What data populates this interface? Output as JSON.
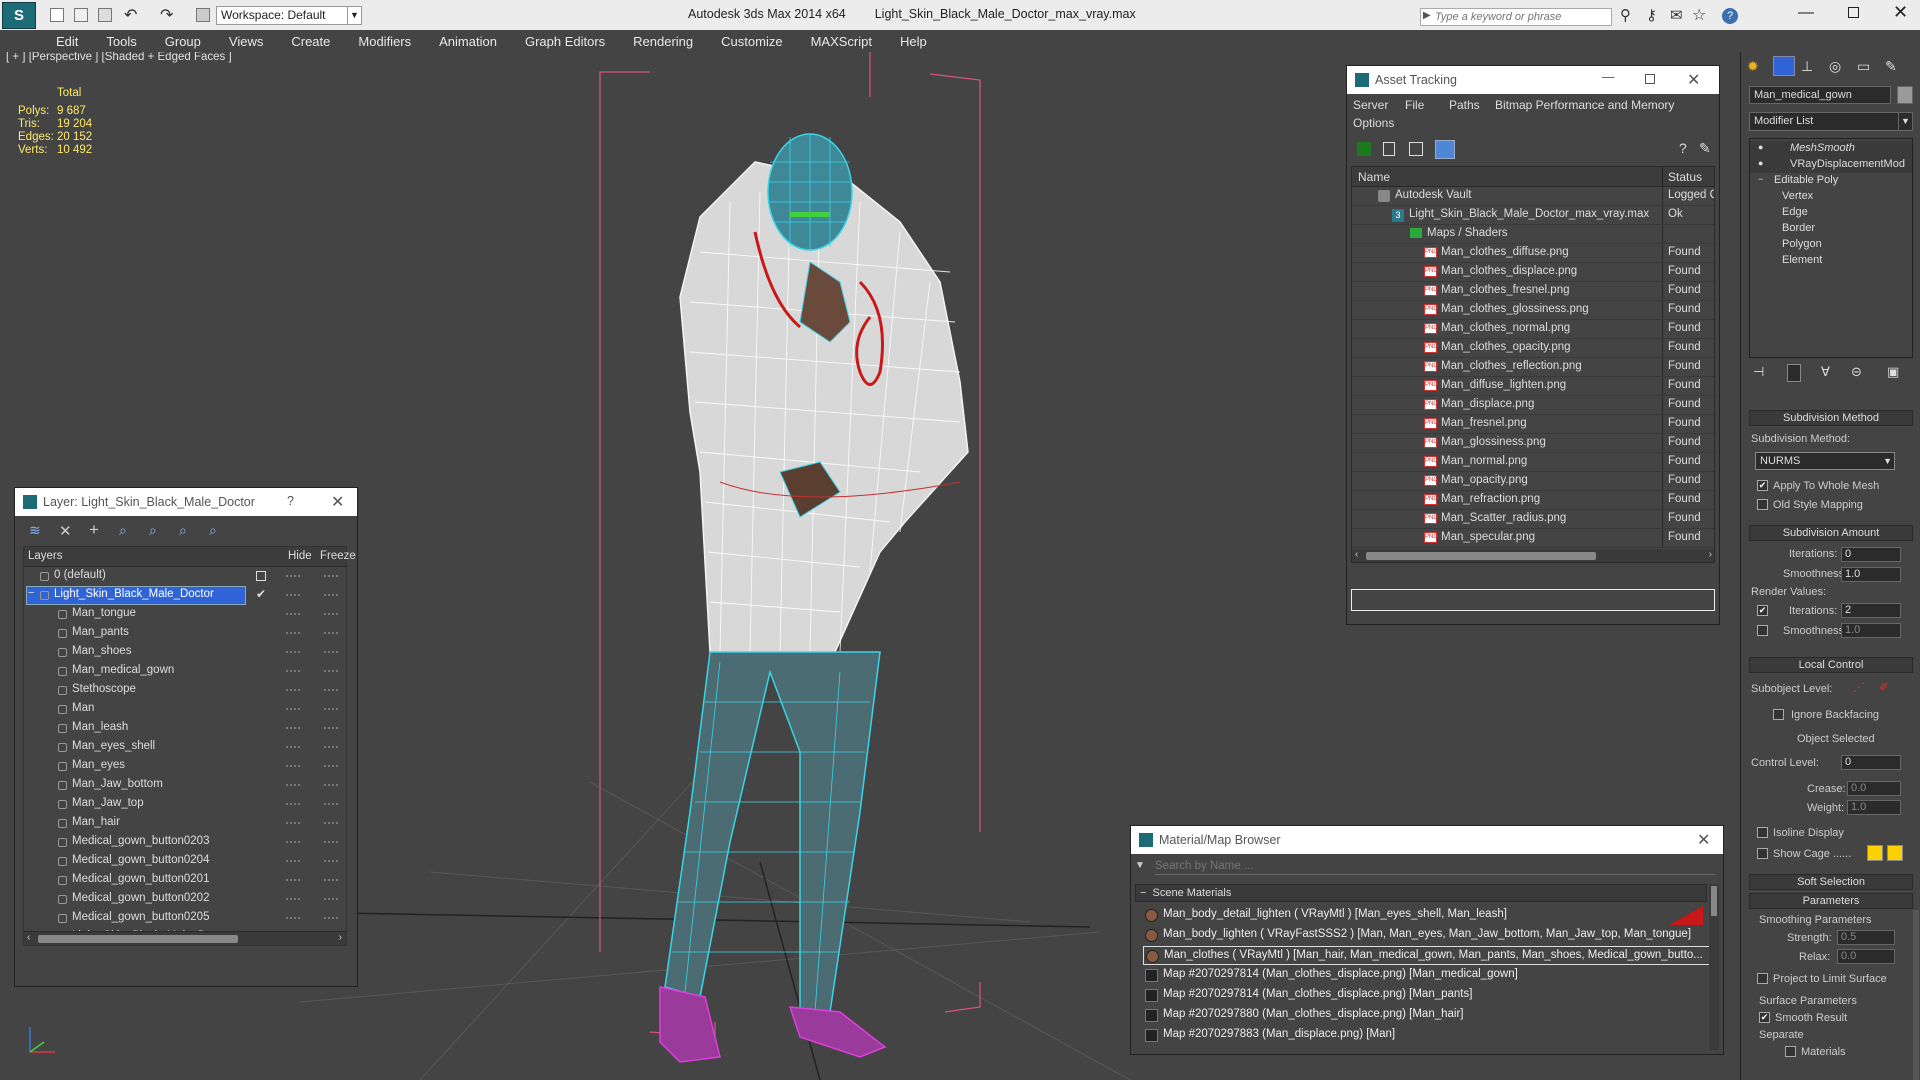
{
  "app": {
    "title": "Autodesk 3ds Max  2014 x64",
    "filename": "Light_Skin_Black_Male_Doctor_max_vray.max",
    "workspace": "Workspace: Default",
    "search_placeholder": "Type a keyword or phrase"
  },
  "menu": [
    "Edit",
    "Tools",
    "Group",
    "Views",
    "Create",
    "Modifiers",
    "Animation",
    "Graph Editors",
    "Rendering",
    "Customize",
    "MAXScript",
    "Help"
  ],
  "viewport": {
    "label": "[ + ] [Perspective ] [Shaded + Edged Faces ]",
    "stats": {
      "header": "Total",
      "rows": [
        {
          "label": "Polys:",
          "value": "9 687"
        },
        {
          "label": "Tris:",
          "value": "19 204"
        },
        {
          "label": "Edges:",
          "value": "20 152"
        },
        {
          "label": "Verts:",
          "value": "10 492"
        }
      ]
    }
  },
  "layer_panel": {
    "title": "Layer: Light_Skin_Black_Male_Doctor",
    "help": "?",
    "col_layers": "Layers",
    "col_hide": "Hide",
    "col_freeze": "Freeze",
    "items": [
      {
        "label": "0 (default)",
        "level": 0
      },
      {
        "label": "Light_Skin_Black_Male_Doctor",
        "level": 0,
        "selected": true
      },
      {
        "label": "Man_tongue",
        "level": 1
      },
      {
        "label": "Man_pants",
        "level": 1
      },
      {
        "label": "Man_shoes",
        "level": 1
      },
      {
        "label": "Man_medical_gown",
        "level": 1
      },
      {
        "label": "Stethoscope",
        "level": 1
      },
      {
        "label": "Man",
        "level": 1
      },
      {
        "label": "Man_leash",
        "level": 1
      },
      {
        "label": "Man_eyes_shell",
        "level": 1
      },
      {
        "label": "Man_eyes",
        "level": 1
      },
      {
        "label": "Man_Jaw_bottom",
        "level": 1
      },
      {
        "label": "Man_Jaw_top",
        "level": 1
      },
      {
        "label": "Man_hair",
        "level": 1
      },
      {
        "label": "Medical_gown_button0203",
        "level": 1
      },
      {
        "label": "Medical_gown_button0204",
        "level": 1
      },
      {
        "label": "Medical_gown_button0201",
        "level": 1
      },
      {
        "label": "Medical_gown_button0202",
        "level": 1
      },
      {
        "label": "Medical_gown_button0205",
        "level": 1
      },
      {
        "label": "Light_Skin_Black_Male_Doctor",
        "level": 1
      }
    ]
  },
  "asset_panel": {
    "title": "Asset Tracking",
    "menu": [
      "Server",
      "File",
      "Paths",
      "Bitmap Performance and Memory",
      "Options"
    ],
    "col_name": "Name",
    "col_status": "Status",
    "rows": [
      {
        "name": "Autodesk Vault",
        "status": "Logged O",
        "level": 0,
        "icon": "vault"
      },
      {
        "name": "Light_Skin_Black_Male_Doctor_max_vray.max",
        "status": "Ok",
        "level": 1,
        "icon": "max"
      },
      {
        "name": "Maps / Shaders",
        "status": "",
        "level": 2,
        "icon": "maps"
      },
      {
        "name": "Man_clothes_diffuse.png",
        "status": "Found",
        "level": 3,
        "icon": "png"
      },
      {
        "name": "Man_clothes_displace.png",
        "status": "Found",
        "level": 3,
        "icon": "png"
      },
      {
        "name": "Man_clothes_fresnel.png",
        "status": "Found",
        "level": 3,
        "icon": "png"
      },
      {
        "name": "Man_clothes_glossiness.png",
        "status": "Found",
        "level": 3,
        "icon": "png"
      },
      {
        "name": "Man_clothes_normal.png",
        "status": "Found",
        "level": 3,
        "icon": "png"
      },
      {
        "name": "Man_clothes_opacity.png",
        "status": "Found",
        "level": 3,
        "icon": "png"
      },
      {
        "name": "Man_clothes_reflection.png",
        "status": "Found",
        "level": 3,
        "icon": "png"
      },
      {
        "name": "Man_diffuse_lighten.png",
        "status": "Found",
        "level": 3,
        "icon": "png"
      },
      {
        "name": "Man_displace.png",
        "status": "Found",
        "level": 3,
        "icon": "png"
      },
      {
        "name": "Man_fresnel.png",
        "status": "Found",
        "level": 3,
        "icon": "png"
      },
      {
        "name": "Man_glossiness.png",
        "status": "Found",
        "level": 3,
        "icon": "png"
      },
      {
        "name": "Man_normal.png",
        "status": "Found",
        "level": 3,
        "icon": "png"
      },
      {
        "name": "Man_opacity.png",
        "status": "Found",
        "level": 3,
        "icon": "png"
      },
      {
        "name": "Man_refraction.png",
        "status": "Found",
        "level": 3,
        "icon": "png"
      },
      {
        "name": "Man_Scatter_radius.png",
        "status": "Found",
        "level": 3,
        "icon": "png"
      },
      {
        "name": "Man_specular.png",
        "status": "Found",
        "level": 3,
        "icon": "png"
      }
    ]
  },
  "material_browser": {
    "title": "Material/Map Browser",
    "search_placeholder": "Search by Name ...",
    "section": "Scene Materials",
    "rows": [
      "Man_body_detail_lighten  ( VRayMtl ) [Man_eyes_shell, Man_leash]",
      "Man_body_lighten  ( VRayFastSSS2 ) [Man, Man_eyes, Man_Jaw_bottom, Man_Jaw_top, Man_tongue]",
      "Man_clothes  ( VRayMtl ) [Man_hair, Man_medical_gown, Man_pants, Man_shoes, Medical_gown_butto...",
      "Map #2070297814 (Man_clothes_displace.png) [Man_medical_gown]",
      "Map #2070297814 (Man_clothes_displace.png) [Man_pants]",
      "Map #2070297880 (Man_clothes_displace.png) [Man_hair]",
      "Map #2070297883 (Man_displace.png) [Man]"
    ]
  },
  "command_panel": {
    "object_name": "Man_medical_gown",
    "modifier_list": "Modifier List",
    "stack": [
      {
        "label": "MeshSmooth",
        "italic": true,
        "level": 0
      },
      {
        "label": "VRayDisplacementMod",
        "italic": false,
        "level": 0
      },
      {
        "label": "Editable Poly",
        "italic": false,
        "level": 0
      },
      {
        "label": "Vertex",
        "level": 1
      },
      {
        "label": "Edge",
        "level": 1
      },
      {
        "label": "Border",
        "level": 1
      },
      {
        "label": "Polygon",
        "level": 1
      },
      {
        "label": "Element",
        "level": 1
      }
    ],
    "subdivision_method_header": "Subdivision Method",
    "subdivision_method_label": "Subdivision Method:",
    "subdivision_method_value": "NURMS",
    "apply_whole_mesh": "Apply To Whole Mesh",
    "old_style_mapping": "Old Style Mapping",
    "subdivision_amount_header": "Subdivision Amount",
    "iterations_label": "Iterations:",
    "iterations_value": "0",
    "smoothness_label": "Smoothness:",
    "smoothness_value": "1.0",
    "render_values_label": "Render Values:",
    "render_iterations_label": "Iterations:",
    "render_iterations_value": "2",
    "render_smoothness_label": "Smoothness:",
    "render_smoothness_value": "1.0",
    "local_control_header": "Local Control",
    "subobject_level_label": "Subobject Level:",
    "ignore_backfacing": "Ignore Backfacing",
    "object_selected": "Object Selected",
    "control_level_label": "Control Level:",
    "control_level_value": "0",
    "crease_label": "Crease:",
    "crease_value": "0.0",
    "weight_label": "Weight:",
    "weight_value": "1.0",
    "isoline_display": "Isoline Display",
    "show_cage": "Show Cage ......",
    "soft_selection_header": "Soft Selection",
    "parameters_header": "Parameters",
    "smoothing_params_label": "Smoothing Parameters",
    "strength_label": "Strength:",
    "strength_value": "0.5",
    "relax_label": "Relax:",
    "relax_value": "0.0",
    "project_limit": "Project to Limit Surface",
    "surface_params_label": "Surface Parameters",
    "smooth_result": "Smooth Result",
    "separate_label": "Separate",
    "materials_label": "Materials"
  },
  "colors": {
    "wire_cyan": "#3ad4e8",
    "wire_white": "#f4f4f4",
    "wire_pink": "#e03ce0",
    "bbox_pink": "#d8557a",
    "selection_blue": "#2f63d6",
    "cage_yellow": "#ffd000"
  }
}
